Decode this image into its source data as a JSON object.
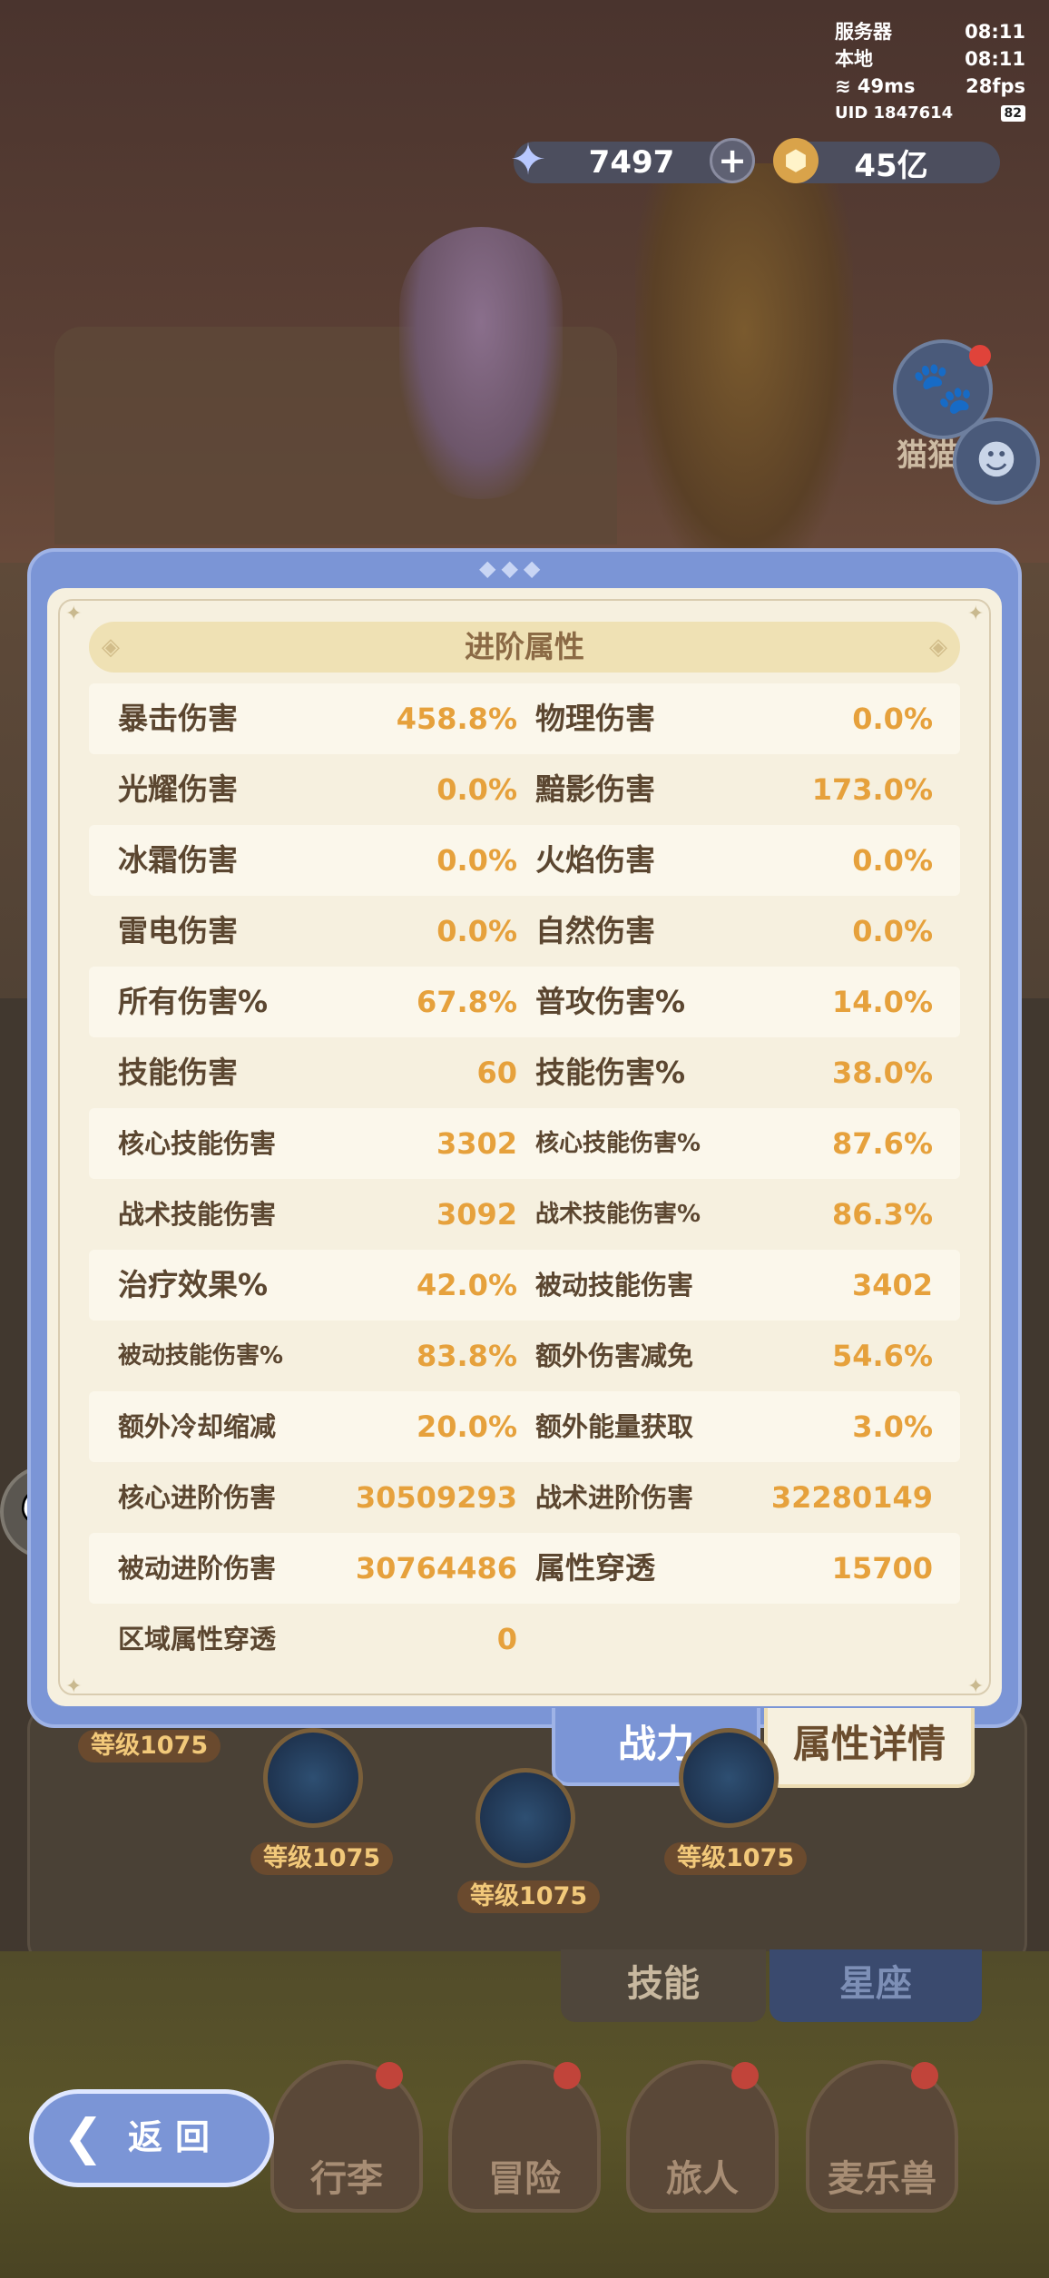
{
  "hud": {
    "server_label": "服务器",
    "server_time": "08:11",
    "local_label": "本地",
    "local_time": "08:11",
    "ping": "49ms",
    "fps": "28fps",
    "uid": "UID 1847614",
    "battery": "82"
  },
  "currency": {
    "stars": "7497",
    "gold": "45亿"
  },
  "side": {
    "cat_label": "猫猫"
  },
  "panel": {
    "title": "进阶属性",
    "rows": [
      {
        "l1": "暴击伤害",
        "v1": "458.8%",
        "l2": "物理伤害",
        "v2": "0.0%"
      },
      {
        "l1": "光耀伤害",
        "v1": "0.0%",
        "l2": "黯影伤害",
        "v2": "173.0%"
      },
      {
        "l1": "冰霜伤害",
        "v1": "0.0%",
        "l2": "火焰伤害",
        "v2": "0.0%"
      },
      {
        "l1": "雷电伤害",
        "v1": "0.0%",
        "l2": "自然伤害",
        "v2": "0.0%"
      },
      {
        "l1": "所有伤害%",
        "v1": "67.8%",
        "l2": "普攻伤害%",
        "v2": "14.0%"
      },
      {
        "l1": "技能伤害",
        "v1": "60",
        "l2": "技能伤害%",
        "v2": "38.0%"
      },
      {
        "l1": "核心技能伤害",
        "v1": "3302",
        "l2": "核心技能伤害%",
        "v2": "87.6%"
      },
      {
        "l1": "战术技能伤害",
        "v1": "3092",
        "l2": "战术技能伤害%",
        "v2": "86.3%"
      },
      {
        "l1": "治疗效果%",
        "v1": "42.0%",
        "l2": "被动技能伤害",
        "v2": "3402"
      },
      {
        "l1": "被动技能伤害%",
        "v1": "83.8%",
        "l2": "额外伤害减免",
        "v2": "54.6%"
      },
      {
        "l1": "额外冷却缩减",
        "v1": "20.0%",
        "l2": "额外能量获取",
        "v2": "3.0%"
      },
      {
        "l1": "核心进阶伤害",
        "v1": "30509293",
        "l2": "战术进阶伤害",
        "v2": "32280149"
      },
      {
        "l1": "被动进阶伤害",
        "v1": "30764486",
        "l2": "属性穿透",
        "v2": "15700"
      },
      {
        "l1": "区域属性穿透",
        "v1": "0",
        "l2": "",
        "v2": ""
      }
    ]
  },
  "tabs": {
    "power": "战力",
    "detail": "属性详情",
    "skill": "技能",
    "constellation": "星座"
  },
  "levels": {
    "lvl_a": "等级1075",
    "lvl_b": "等级1075",
    "lvl_c": "等级1075",
    "lvl_d": "等级1075"
  },
  "nav": {
    "bag": "行李",
    "adventure": "冒险",
    "traveler": "旅人",
    "pet": "麦乐兽"
  },
  "back": {
    "label": "返回"
  },
  "colors": {
    "panel_blue": "#7b95d6",
    "panel_cream": "#f6f0df",
    "value_orange": "#e6a13c",
    "label_brown": "#5b4630"
  }
}
